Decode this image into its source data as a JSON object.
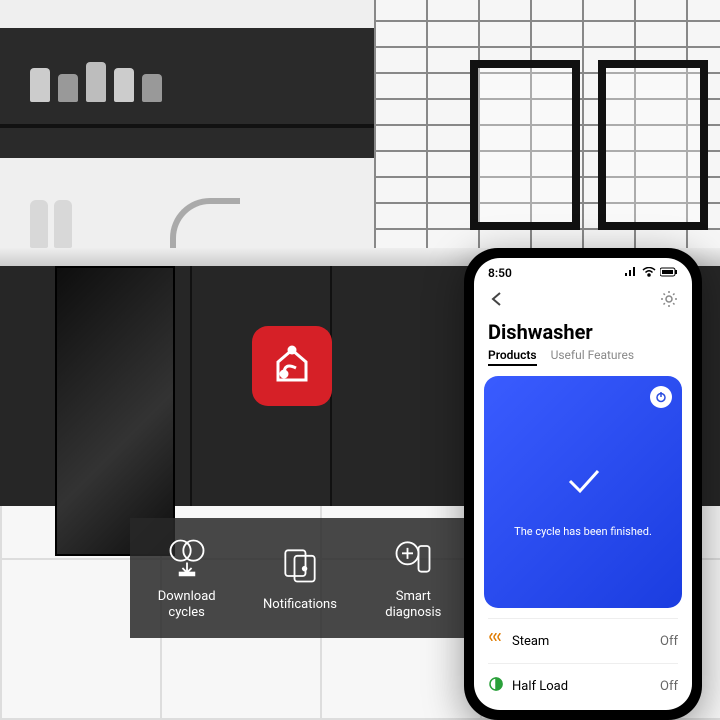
{
  "badge": {
    "color": "#d62027"
  },
  "features": [
    {
      "label": "Download\ncycles",
      "icon": "download-cycles"
    },
    {
      "label": "Notifications",
      "icon": "notifications"
    },
    {
      "label": "Smart\ndiagnosis",
      "icon": "smart-diagnosis"
    }
  ],
  "phone": {
    "status_time": "8:50",
    "header": {
      "title": "Dishwasher"
    },
    "tabs": {
      "products": "Products",
      "useful": "Useful Features"
    },
    "card": {
      "status_text": "The cycle has been finished."
    },
    "settings": [
      {
        "label": "Steam",
        "value": "Off",
        "icon": "steam"
      },
      {
        "label": "Half Load",
        "value": "Off",
        "icon": "halfload"
      }
    ]
  }
}
